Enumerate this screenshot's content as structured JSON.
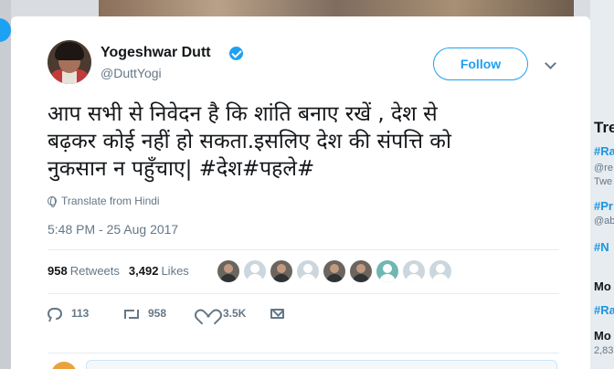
{
  "tweet": {
    "author_name": "Yogeshwar Dutt",
    "author_handle": "@DuttYogi",
    "follow_label": "Follow",
    "text_lines": [
      "आप सभी से निवेदन है कि शांति बनाए रखें , देश से",
      "बढ़कर कोई नहीं हो सकता.इसलिए देश की संपत्ति को",
      "नुकसान न पहुँचाए| #देश#पहले#"
    ],
    "translate_label": "Translate from Hindi",
    "timestamp": "5:48 PM - 25 Aug 2017",
    "retweets_count": "958",
    "retweets_label": "Retweets",
    "likes_count": "3,492",
    "likes_label": "Likes",
    "actions": {
      "replies": "113",
      "retweets": "958",
      "likes": "3.5K"
    }
  },
  "background_sidebar": {
    "heading": "Tre",
    "items": [
      {
        "tag": "#Ra",
        "sub": "@re"
      },
      {
        "tag": "",
        "sub": "Twe"
      },
      {
        "tag": "#Pr",
        "sub": "@ab"
      },
      {
        "tag": "#N",
        "sub": ""
      },
      {
        "tag": "Mo",
        "sub": ""
      },
      {
        "tag": "#Ra",
        "sub": ""
      },
      {
        "tag": "Mo",
        "sub": "2,83"
      }
    ]
  },
  "colors": {
    "accent": "#1da1f2",
    "text_primary": "#14171a",
    "text_secondary": "#657786"
  },
  "icons": [
    "verified-icon",
    "chevron-down-icon",
    "globe-icon",
    "reply-icon",
    "retweet-icon",
    "heart-icon",
    "mail-icon"
  ]
}
